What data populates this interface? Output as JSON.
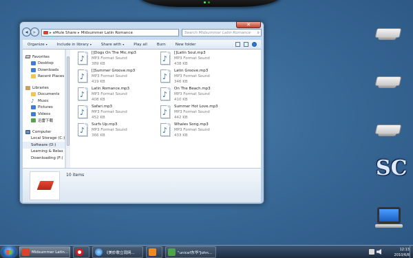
{
  "window": {
    "address_parts": [
      "eMule Share",
      "Midsummer Latin Romance"
    ],
    "address_separator": "▸",
    "search_placeholder": "Search Midsummer Latin Romance",
    "close_glyph": "✕",
    "back_glyph": "◂",
    "forward_glyph": "▸",
    "search_glyph": "⌕"
  },
  "toolbar": {
    "organize": "Organize",
    "include_in_library": "Include in library",
    "share_with": "Share with",
    "play_all": "Play all",
    "burn": "Burn",
    "new_folder": "New folder",
    "dropdown_glyph": "▾"
  },
  "nav_pane": {
    "favorites": "Favorites",
    "desktop": "Desktop",
    "downloads": "Downloads",
    "recent_places": "Recent Places",
    "libraries": "Libraries",
    "documents": "Documents",
    "music": "Music",
    "pictures": "Pictures",
    "videos": "Videos",
    "xunlei": "迅雷下载",
    "computer": "Computer",
    "local_storage": "Local Storage (C:)",
    "software": "Software (D:)",
    "learning": "Learning & Relax",
    "downloading": "Downloading (F:)",
    "star_glyph": "★",
    "note_glyph": "♪"
  },
  "files": [
    {
      "name": "[]Dogs On The Mic.mp3",
      "type": "MP3 Format Sound",
      "size": "389 KB"
    },
    {
      "name": "[]Latin Soul.mp3",
      "type": "MP3 Format Sound",
      "size": "438 KB"
    },
    {
      "name": "[]Summer Groove.mp3",
      "type": "MP3 Format Sound",
      "size": "419 KB"
    },
    {
      "name": "Latin Groove.mp3",
      "type": "MP3 Format Sound",
      "size": "346 KB"
    },
    {
      "name": "Latin Romance.mp3",
      "type": "MP3 Format Sound",
      "size": "408 KB"
    },
    {
      "name": "On The Beach.mp3",
      "type": "MP3 Format Sound",
      "size": "410 KB"
    },
    {
      "name": "Safari.mp3",
      "type": "MP3 Format Sound",
      "size": "452 KB"
    },
    {
      "name": "Summer Hot Love.mp3",
      "type": "MP3 Format Sound",
      "size": "442 KB"
    },
    {
      "name": "Surfs Up.mp3",
      "type": "MP3 Format Sound",
      "size": "366 KB"
    },
    {
      "name": "Whales Song.mp3",
      "type": "MP3 Format Sound",
      "size": "433 KB"
    }
  ],
  "file_icon_glyph": "♪",
  "details": {
    "item_count": "10 items"
  },
  "desktop": {
    "sc_logo": "SC"
  },
  "taskbar": {
    "explorer_task": "Midsummer Latin...",
    "ie_task": "《美妙歌立现网...",
    "app_task": "\"unicef东华\"John...",
    "time": "12:13",
    "date": "2010/6/8"
  },
  "colors": {
    "accent": "#2467c9",
    "desktop_bg": "#3a6a97",
    "taskbar_bg": "#1d2c3f"
  }
}
